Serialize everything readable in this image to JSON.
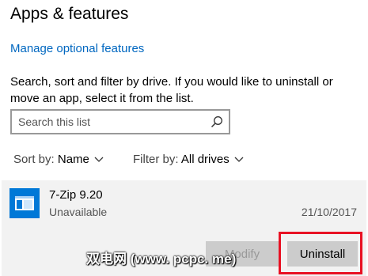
{
  "header": {
    "title": "Apps & features",
    "manage_link": "Manage optional features"
  },
  "description": "Search, sort and filter by drive. If you would like to uninstall or move an app, select it from the list.",
  "search": {
    "placeholder": "Search this list",
    "value": "",
    "icon": "search-icon"
  },
  "filters": {
    "sort_label": "Sort by:",
    "sort_value": "Name",
    "filter_label": "Filter by:",
    "filter_value": "All drives"
  },
  "apps": [
    {
      "name": "7-Zip 9.20",
      "status": "Unavailable",
      "date": "21/10/2017",
      "icon": "app-window-icon",
      "modify_label": "Modify",
      "uninstall_label": "Uninstall"
    }
  ],
  "watermark": "双电网 (www. pcpc. me)",
  "colors": {
    "accent": "#0067c0",
    "app_icon": "#0078d7",
    "card_bg": "#f2f2f2",
    "button_bg": "#cccccc",
    "highlight": "#e81123"
  }
}
